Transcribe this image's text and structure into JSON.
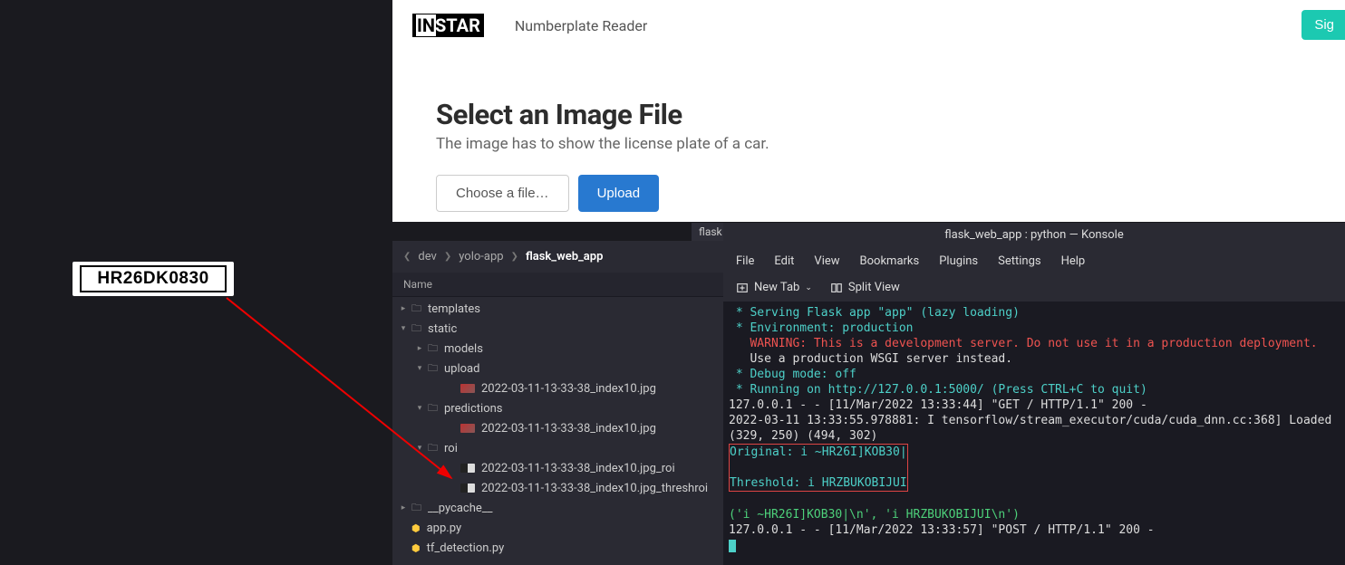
{
  "plate": {
    "text": "HR26DK0830"
  },
  "webapp": {
    "logo_in": "IN",
    "logo_star": "STAR",
    "title": "Numberplate Reader",
    "signin": "Sig",
    "heading": "Select an Image File",
    "subtitle": "The image has to show the license plate of a car.",
    "choose": "Choose a file…",
    "upload": "Upload"
  },
  "flask_tab": {
    "label": "flask"
  },
  "explorer": {
    "crumbs": [
      "dev",
      "yolo-app",
      "flask_web_app"
    ],
    "col": "Name",
    "rows": [
      {
        "depth": 0,
        "twist": "right",
        "icon": "folder",
        "label": "templates"
      },
      {
        "depth": 0,
        "twist": "down",
        "icon": "folder",
        "label": "static"
      },
      {
        "depth": 1,
        "twist": "right",
        "icon": "folder",
        "label": "models"
      },
      {
        "depth": 1,
        "twist": "down",
        "icon": "folder",
        "label": "upload"
      },
      {
        "depth": 3,
        "twist": "",
        "icon": "img",
        "label": "2022-03-11-13-33-38_index10.jpg"
      },
      {
        "depth": 1,
        "twist": "down",
        "icon": "folder",
        "label": "predictions"
      },
      {
        "depth": 3,
        "twist": "",
        "icon": "img",
        "label": "2022-03-11-13-33-38_index10.jpg"
      },
      {
        "depth": 1,
        "twist": "down",
        "icon": "folder",
        "label": "roi"
      },
      {
        "depth": 3,
        "twist": "",
        "icon": "bw",
        "label": "2022-03-11-13-33-38_index10.jpg_roi"
      },
      {
        "depth": 3,
        "twist": "",
        "icon": "bw",
        "label": "2022-03-11-13-33-38_index10.jpg_threshroi"
      },
      {
        "depth": 0,
        "twist": "right",
        "icon": "folder",
        "label": "__pycache__"
      },
      {
        "depth": 0,
        "twist": "",
        "icon": "py",
        "label": "app.py"
      },
      {
        "depth": 0,
        "twist": "",
        "icon": "py",
        "label": "tf_detection.py"
      }
    ]
  },
  "konsole": {
    "title": "flask_web_app : python — Konsole",
    "menu": [
      "File",
      "Edit",
      "View",
      "Bookmarks",
      "Plugins",
      "Settings",
      "Help"
    ],
    "newtab": "New Tab",
    "splitview": "Split View",
    "lines": [
      {
        "cls": "c-cyan",
        "text": " * Serving Flask app \"app\" (lazy loading)"
      },
      {
        "cls": "c-cyan",
        "text": " * Environment: production"
      },
      {
        "cls": "c-red",
        "text": "   WARNING: This is a development server. Do not use it in a production deployment."
      },
      {
        "cls": "c-white",
        "text": "   Use a production WSGI server instead."
      },
      {
        "cls": "c-cyan",
        "text": " * Debug mode: off"
      },
      {
        "cls": "c-cyan",
        "text": " * Running on http://127.0.0.1:5000/ (Press CTRL+C to quit)"
      },
      {
        "cls": "c-white",
        "text": "127.0.0.1 - - [11/Mar/2022 13:33:44] \"GET / HTTP/1.1\" 200 -"
      },
      {
        "cls": "c-white",
        "text": "2022-03-11 13:33:55.978881: I tensorflow/stream_executor/cuda/cuda_dnn.cc:368] Loaded"
      },
      {
        "cls": "c-white",
        "text": "(329, 250) (494, 302)"
      }
    ],
    "boxed": [
      {
        "cls": "c-cyan",
        "text": "Original: i ~HR26I]KOB30|"
      },
      {
        "cls": "c-cyan",
        "text": ""
      },
      {
        "cls": "c-cyan",
        "text": "Threshold: i HRZBUKOBIJUI"
      }
    ],
    "after": [
      {
        "cls": "c-green",
        "text": "('i ~HR26I]KOB30|\\n', 'i HRZBUKOBIJUI\\n')"
      },
      {
        "cls": "c-white",
        "text": "127.0.0.1 - - [11/Mar/2022 13:33:57] \"POST / HTTP/1.1\" 200 -"
      }
    ]
  }
}
